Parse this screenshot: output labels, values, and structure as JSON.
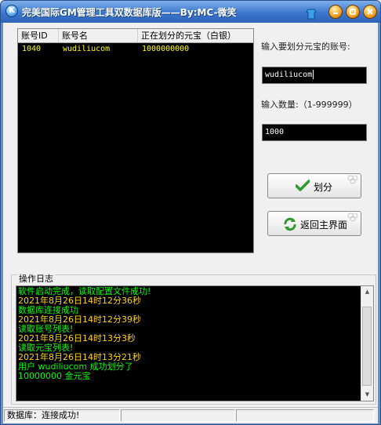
{
  "window": {
    "title": "完美国际GM管理工具双数据库版——By:MC-微笑",
    "app_icon": "app-icon",
    "controls": [
      "skin-icon",
      "minimize-icon",
      "maximize-icon",
      "close-icon"
    ]
  },
  "account_list": {
    "columns": [
      "账号ID",
      "账号名",
      "正在划分的元宝（白银）"
    ],
    "rows": [
      {
        "id": "1040",
        "name": "wudiliucom",
        "amount": "1000000000"
      }
    ]
  },
  "form": {
    "account_label": "输入要划分元宝的账号:",
    "account_value": "wudiliucom",
    "quantity_label": "输入数量:（1-999999）",
    "quantity_value": "1000",
    "transfer_button": "划分",
    "back_button": "返回主界面"
  },
  "log": {
    "title": "操作日志",
    "lines": [
      {
        "text": "软件启动完成，读取配置文件成功!",
        "color": "#00ff00"
      },
      {
        "text": "2021年8月26日14时12分36秒",
        "color": "#ffd700"
      },
      {
        "text": "数据库连接成功",
        "color": "#00ff00"
      },
      {
        "text": "2021年8月26日14时12分39秒",
        "color": "#ffd700"
      },
      {
        "text": "读取账号列表!",
        "color": "#00ff00"
      },
      {
        "text": "2021年8月26日14时13分3秒",
        "color": "#ffd700"
      },
      {
        "text": "读取元宝列表!",
        "color": "#00ff00"
      },
      {
        "text": "2021年8月26日14时13分21秒",
        "color": "#ffd700"
      },
      {
        "text": "用户 wudiliucom 成功划分了",
        "color": "#00ff00"
      },
      {
        "text": "10000000 金元宝",
        "color": "#00ff00"
      }
    ]
  },
  "statusbar": {
    "db_status": "数据库：连接成功!",
    "panel2": "",
    "panel3": ""
  },
  "colors": {
    "title_bar": "#3c77cf",
    "list_text": "#ffff00",
    "log_ok": "#00ff00",
    "log_time": "#ffd700"
  }
}
